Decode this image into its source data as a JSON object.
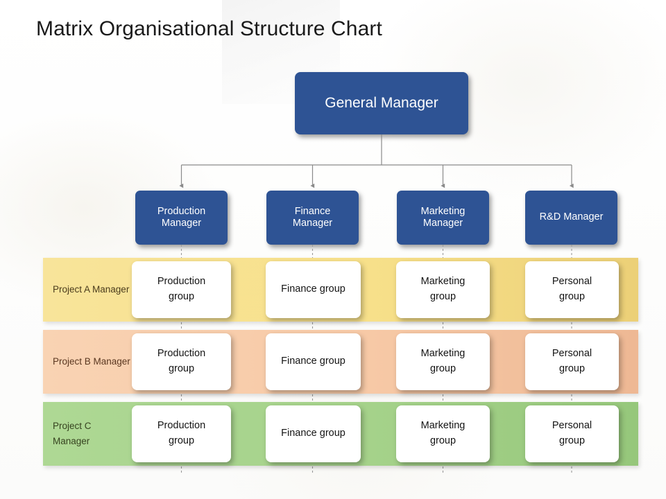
{
  "title": "Matrix Organisational Structure Chart",
  "colors": {
    "node_blue": "#2E5394",
    "band_a": "#F7E08A",
    "band_b": "#F7C9A6",
    "band_c": "#A5D28A",
    "card_white": "#FFFFFF",
    "connector_gray": "#808080",
    "background": "#FFFFFF"
  },
  "root": {
    "label": "General Manager"
  },
  "managers": [
    {
      "label": "Production\nManager"
    },
    {
      "label": "Finance\nManager"
    },
    {
      "label": "Marketing\nManager"
    },
    {
      "label": "R&D Manager"
    }
  ],
  "project_rows": [
    {
      "label": "Project A\nManager",
      "color": "#F7E08A",
      "cells": [
        {
          "label": "Production\ngroup"
        },
        {
          "label": "Finance group"
        },
        {
          "label": "Marketing\ngroup"
        },
        {
          "label": "Personal\ngroup"
        }
      ]
    },
    {
      "label": "Project B\nManager",
      "color": "#F7C9A6",
      "cells": [
        {
          "label": "Production\ngroup"
        },
        {
          "label": "Finance group"
        },
        {
          "label": "Marketing\ngroup"
        },
        {
          "label": "Personal\ngroup"
        }
      ]
    },
    {
      "label": "Project C\nManager",
      "color": "#A5D28A",
      "cells": [
        {
          "label": "Production\ngroup"
        },
        {
          "label": "Finance group"
        },
        {
          "label": "Marketing\ngroup"
        },
        {
          "label": "Personal\ngroup"
        }
      ]
    }
  ]
}
